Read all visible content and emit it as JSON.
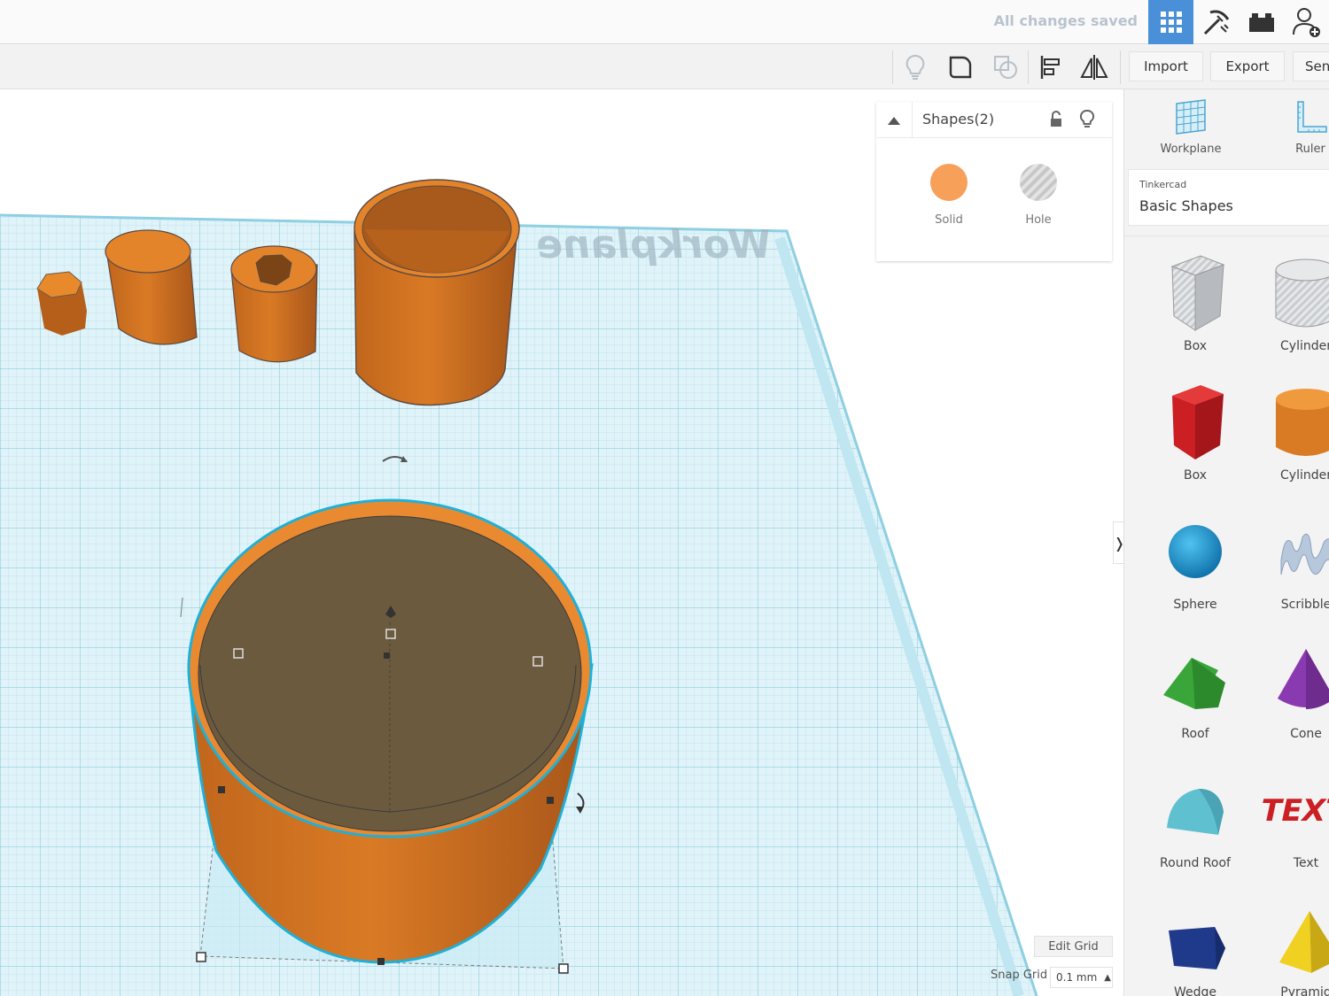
{
  "header": {
    "save_status": "All changes saved",
    "icons": [
      "3d-view-grid-icon",
      "pickaxe-icon",
      "bricks-icon",
      "add-user-icon"
    ]
  },
  "toolbar": {
    "import_label": "Import",
    "export_label": "Export",
    "send_label": "Sen"
  },
  "workplane": {
    "watermark": "Workplane"
  },
  "inspector": {
    "title": "Shapes(2)",
    "solid_label": "Solid",
    "hole_label": "Hole",
    "solid_color": "#f7a05a"
  },
  "grid": {
    "edit_label": "Edit Grid",
    "snap_label": "Snap Grid",
    "snap_value": "0.1 mm"
  },
  "library": {
    "tools": [
      {
        "label": "Workplane"
      },
      {
        "label": "Ruler"
      }
    ],
    "brand": "Tinkercad",
    "category": "Basic Shapes",
    "shapes": [
      {
        "label": "Box",
        "icon": "box-hole-icon"
      },
      {
        "label": "Cylinder",
        "icon": "cylinder-hole-icon"
      },
      {
        "label": "Box",
        "icon": "box-icon"
      },
      {
        "label": "Cylinder",
        "icon": "cylinder-icon"
      },
      {
        "label": "Sphere",
        "icon": "sphere-icon"
      },
      {
        "label": "Scribble",
        "icon": "scribble-icon"
      },
      {
        "label": "Roof",
        "icon": "roof-icon"
      },
      {
        "label": "Cone",
        "icon": "cone-icon"
      },
      {
        "label": "Round Roof",
        "icon": "round-roof-icon"
      },
      {
        "label": "Text",
        "icon": "text-icon"
      },
      {
        "label": "Wedge",
        "icon": "wedge-icon"
      },
      {
        "label": "Pyramid",
        "icon": "pyramid-icon"
      }
    ]
  },
  "colors": {
    "accent": "#4a90d9",
    "orange": "#e07f24",
    "red": "#cc1f24",
    "blue_sphere": "#1a8fd0",
    "green_roof": "#3aa63a",
    "purple_cone": "#8a3ab0",
    "teal_roof": "#5fc0d0",
    "navy_wedge": "#1f3a8a",
    "yellow_pyramid": "#f0d020"
  }
}
